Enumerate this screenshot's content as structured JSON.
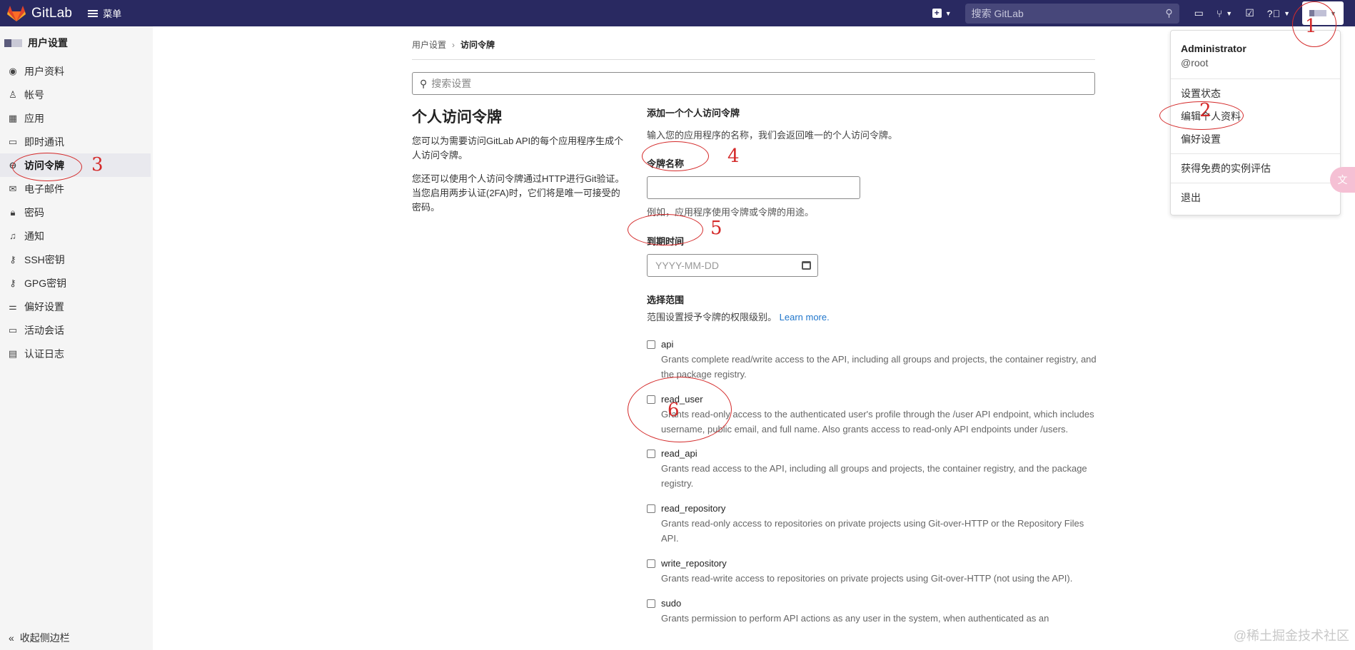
{
  "colors": {
    "topbar": "#292961",
    "annotation": "#d42a2a",
    "link": "#1f75cb"
  },
  "topbar": {
    "brand": "GitLab",
    "menu_label": "菜单",
    "search_placeholder": "搜索 GitLab",
    "icons": [
      "plus-icon",
      "issues-icon",
      "merge-request-icon",
      "todo-icon",
      "help-icon"
    ]
  },
  "sidebar": {
    "title": "用户设置",
    "items": [
      {
        "label": "用户资料",
        "icon": "profile-icon"
      },
      {
        "label": "帐号",
        "icon": "account-icon"
      },
      {
        "label": "应用",
        "icon": "applications-icon"
      },
      {
        "label": "即时通讯",
        "icon": "chat-icon"
      },
      {
        "label": "访问令牌",
        "icon": "token-icon"
      },
      {
        "label": "电子邮件",
        "icon": "mail-icon"
      },
      {
        "label": "密码",
        "icon": "lock-icon"
      },
      {
        "label": "通知",
        "icon": "bell-icon"
      },
      {
        "label": "SSH密钥",
        "icon": "key-icon"
      },
      {
        "label": "GPG密钥",
        "icon": "key-icon"
      },
      {
        "label": "偏好设置",
        "icon": "preferences-icon"
      },
      {
        "label": "活动会话",
        "icon": "monitor-icon"
      },
      {
        "label": "认证日志",
        "icon": "log-icon"
      }
    ],
    "collapse_label": "收起侧边栏"
  },
  "breadcrumb": {
    "parent": "用户设置",
    "current": "访问令牌"
  },
  "settings_search": {
    "placeholder": "搜索设置"
  },
  "intro": {
    "title": "个人访问令牌",
    "p1": "您可以为需要访问GitLab API的每个应用程序生成个人访问令牌。",
    "p2": "您还可以使用个人访问令牌通过HTTP进行Git验证。 当您启用两步认证(2FA)时，它们将是唯一可接受的密码。"
  },
  "form": {
    "heading": "添加一个个人访问令牌",
    "description": "输入您的应用程序的名称，我们会返回唯一的个人访问令牌。",
    "name_label": "令牌名称",
    "name_help": "例如，应用程序使用令牌或令牌的用途。",
    "expiry_label": "到期时间",
    "expiry_placeholder": "YYYY-MM-DD",
    "scopes_label": "选择范围",
    "scopes_help": "范围设置授予令牌的权限级别。",
    "learn_more": "Learn more.",
    "scopes": [
      {
        "name": "api",
        "desc": "Grants complete read/write access to the API, including all groups and projects, the container registry, and the package registry."
      },
      {
        "name": "read_user",
        "desc": "Grants read-only access to the authenticated user's profile through the /user API endpoint, which includes username, public email, and full name. Also grants access to read-only API endpoints under /users."
      },
      {
        "name": "read_api",
        "desc": "Grants read access to the API, including all groups and projects, the container registry, and the package registry."
      },
      {
        "name": "read_repository",
        "desc": "Grants read-only access to repositories on private projects using Git-over-HTTP or the Repository Files API."
      },
      {
        "name": "write_repository",
        "desc": "Grants read-write access to repositories on private projects using Git-over-HTTP (not using the API)."
      },
      {
        "name": "sudo",
        "desc": "Grants permission to perform API actions as any user in the system, when authenticated as an"
      }
    ]
  },
  "user_menu": {
    "name": "Administrator",
    "username": "@root",
    "items": [
      "设置状态",
      "编辑个人资料",
      "偏好设置",
      "获得免费的实例评估",
      "退出"
    ]
  },
  "side_pill_icon": "translate-icon",
  "annotations": [
    "1",
    "2",
    "3",
    "4",
    "5",
    "6"
  ],
  "watermark": "@稀土掘金技术社区"
}
